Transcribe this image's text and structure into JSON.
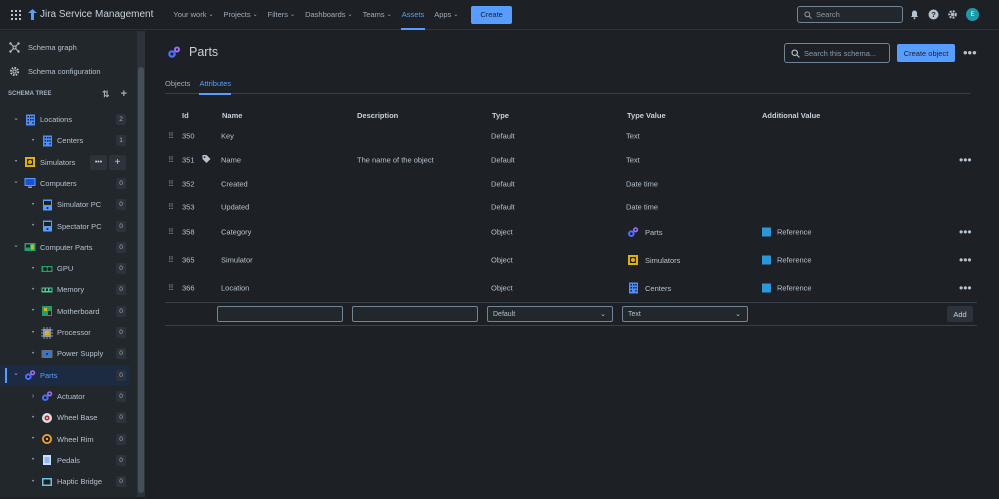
{
  "topbar": {
    "product": "Jira Service Management",
    "nav": [
      {
        "label": "Your work",
        "chevron": true,
        "active": false
      },
      {
        "label": "Projects",
        "chevron": true,
        "active": false
      },
      {
        "label": "Filters",
        "chevron": true,
        "active": false
      },
      {
        "label": "Dashboards",
        "chevron": true,
        "active": false
      },
      {
        "label": "Teams",
        "chevron": true,
        "active": false
      },
      {
        "label": "Assets",
        "chevron": false,
        "active": true
      },
      {
        "label": "Apps",
        "chevron": true,
        "active": false
      }
    ],
    "create_label": "Create",
    "search_placeholder": "Search",
    "avatar_initial": "E"
  },
  "sidebar": {
    "links": [
      {
        "label": "Schema graph",
        "icon": "schema-graph-icon"
      },
      {
        "label": "Schema configuration",
        "icon": "gear-icon"
      }
    ],
    "tree_title": "SCHEMA TREE",
    "tree": [
      {
        "label": "Locations",
        "count": "2",
        "level": 0,
        "toggle": "down",
        "icon": "building",
        "selected": false
      },
      {
        "label": "Centers",
        "count": "1",
        "level": 1,
        "toggle": "dot",
        "icon": "building",
        "selected": false
      },
      {
        "label": "Simulators",
        "count": "",
        "level": 0,
        "toggle": "dot",
        "icon": "simulator",
        "selected": false,
        "hover": true
      },
      {
        "label": "Computers",
        "count": "0",
        "level": 0,
        "toggle": "down",
        "icon": "computer",
        "selected": false
      },
      {
        "label": "Simulator PC",
        "count": "0",
        "level": 1,
        "toggle": "dot",
        "icon": "pc",
        "selected": false
      },
      {
        "label": "Spectator PC",
        "count": "0",
        "level": 1,
        "toggle": "dot",
        "icon": "pc",
        "selected": false
      },
      {
        "label": "Computer Parts",
        "count": "0",
        "level": 0,
        "toggle": "down",
        "icon": "computer-parts",
        "selected": false
      },
      {
        "label": "GPU",
        "count": "0",
        "level": 1,
        "toggle": "dot",
        "icon": "gpu",
        "selected": false
      },
      {
        "label": "Memory",
        "count": "0",
        "level": 1,
        "toggle": "dot",
        "icon": "memory",
        "selected": false
      },
      {
        "label": "Motherboard",
        "count": "0",
        "level": 1,
        "toggle": "dot",
        "icon": "motherboard",
        "selected": false
      },
      {
        "label": "Processor",
        "count": "0",
        "level": 1,
        "toggle": "dot",
        "icon": "processor",
        "selected": false
      },
      {
        "label": "Power Supply",
        "count": "0",
        "level": 1,
        "toggle": "dot",
        "icon": "power-supply",
        "selected": false
      },
      {
        "label": "Parts",
        "count": "0",
        "level": 0,
        "toggle": "down",
        "icon": "parts",
        "selected": true
      },
      {
        "label": "Actuator",
        "count": "0",
        "level": 1,
        "toggle": "right",
        "icon": "parts",
        "selected": false
      },
      {
        "label": "Wheel Base",
        "count": "0",
        "level": 1,
        "toggle": "dot",
        "icon": "wheel-base",
        "selected": false
      },
      {
        "label": "Wheel Rim",
        "count": "0",
        "level": 1,
        "toggle": "dot",
        "icon": "wheel-rim",
        "selected": false
      },
      {
        "label": "Pedals",
        "count": "0",
        "level": 1,
        "toggle": "dot",
        "icon": "pedals",
        "selected": false
      },
      {
        "label": "Haptic Bridge",
        "count": "0",
        "level": 1,
        "toggle": "dot",
        "icon": "haptic",
        "selected": false
      }
    ]
  },
  "main": {
    "title": "Parts",
    "schema_search_placeholder": "Search this schema...",
    "create_object_label": "Create object",
    "tabs": [
      {
        "label": "Objects",
        "active": false
      },
      {
        "label": "Attributes",
        "active": true
      }
    ],
    "columns": [
      "Id",
      "Name",
      "Description",
      "Type",
      "Type Value",
      "Additional Value"
    ],
    "rows": [
      {
        "id": "350",
        "name": "Key",
        "description": "",
        "type": "Default",
        "type_value": "Text",
        "type_value_icon": "",
        "additional": "",
        "label_icon": false,
        "more": false
      },
      {
        "id": "351",
        "name": "Name",
        "description": "The name of the object",
        "type": "Default",
        "type_value": "Text",
        "type_value_icon": "",
        "additional": "",
        "label_icon": true,
        "more": true
      },
      {
        "id": "352",
        "name": "Created",
        "description": "",
        "type": "Default",
        "type_value": "Date time",
        "type_value_icon": "",
        "additional": "",
        "label_icon": false,
        "more": false
      },
      {
        "id": "353",
        "name": "Updated",
        "description": "",
        "type": "Default",
        "type_value": "Date time",
        "type_value_icon": "",
        "additional": "",
        "label_icon": false,
        "more": false
      },
      {
        "id": "358",
        "name": "Category",
        "description": "",
        "type": "Object",
        "type_value": "Parts",
        "type_value_icon": "parts",
        "additional": "Reference",
        "label_icon": false,
        "more": true
      },
      {
        "id": "365",
        "name": "Simulator",
        "description": "",
        "type": "Object",
        "type_value": "Simulators",
        "type_value_icon": "simulator",
        "additional": "Reference",
        "label_icon": false,
        "more": true
      },
      {
        "id": "366",
        "name": "Location",
        "description": "",
        "type": "Object",
        "type_value": "Centers",
        "type_value_icon": "building",
        "additional": "Reference",
        "label_icon": false,
        "more": true
      }
    ],
    "new_row": {
      "name_value": "",
      "description_value": "",
      "type_selected": "Default",
      "type_value_selected": "Text",
      "add_label": "Add"
    }
  },
  "colors": {
    "accent": "#579dff",
    "background": "#1d2125",
    "sidebar": "#22272b",
    "reference_square": "#2898d8"
  }
}
